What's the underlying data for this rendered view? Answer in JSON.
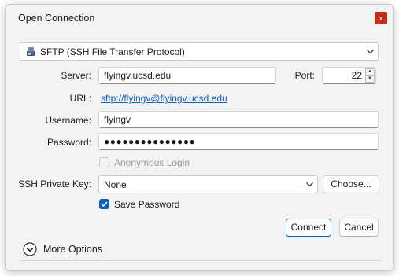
{
  "window": {
    "title": "Open Connection",
    "close_glyph": "x"
  },
  "protocol": {
    "selected": "SFTP (SSH File Transfer Protocol)",
    "icon": "server-drive-icon"
  },
  "server": {
    "label": "Server:",
    "value": "flyingv.ucsd.edu"
  },
  "port": {
    "label": "Port:",
    "value": "22"
  },
  "url": {
    "label": "URL:",
    "value": "sftp://flyingv@flyingv.ucsd.edu"
  },
  "username": {
    "label": "Username:",
    "value": "flyingv"
  },
  "password": {
    "label": "Password:",
    "value": "●●●●●●●●●●●●●●●"
  },
  "anonymous": {
    "label": "Anonymous Login",
    "checked": false,
    "enabled": false
  },
  "ssh_key": {
    "label": "SSH Private Key:",
    "selected": "None",
    "choose_label": "Choose..."
  },
  "save_password": {
    "label": "Save Password",
    "checked": true
  },
  "buttons": {
    "connect": "Connect",
    "cancel": "Cancel"
  },
  "more_options": {
    "label": "More Options"
  },
  "colors": {
    "accent": "#0a5fbd",
    "close": "#c42b1c"
  }
}
